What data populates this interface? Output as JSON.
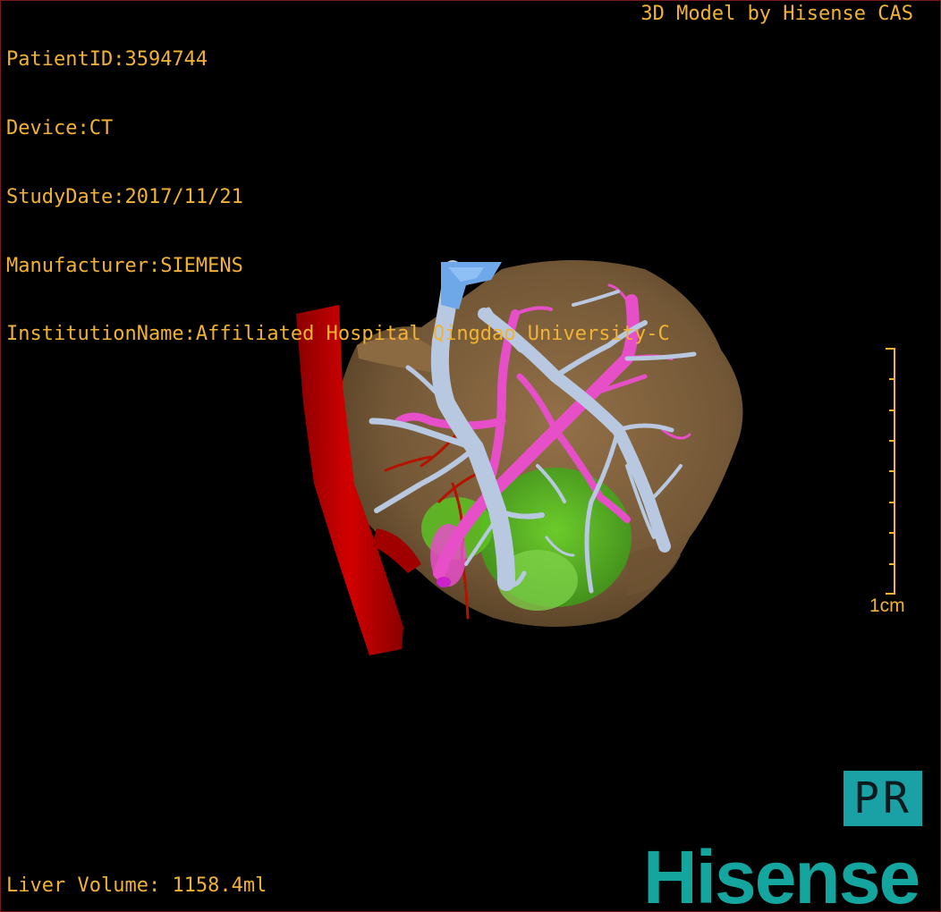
{
  "patient_info": [
    {
      "label": "PatientID:",
      "value": "3594744"
    },
    {
      "label": "Device:",
      "value": "CT"
    },
    {
      "label": "StudyDate:",
      "value": "2017/11/21"
    },
    {
      "label": "Manufacturer:",
      "value": "SIEMENS"
    },
    {
      "label": "InstitutionName:",
      "value": "Affiliated Hospital Qingdao University-C"
    }
  ],
  "credit": "3D Model by Hisense CAS",
  "footer": {
    "volume_label": "Liver Volume:",
    "volume_value": "1158.4ml"
  },
  "scale_bar": {
    "label": "1cm"
  },
  "pr_button_label": "PR",
  "brand": "Hisense",
  "colors": {
    "overlay_text": "#f2b233",
    "liver": "#8a6a45",
    "hepatic_vein": "#b7c8e0",
    "portal_vein": "#e64fc8",
    "ivc": "#c00000",
    "tumor": "#55c41e",
    "brand": "#14a59f"
  },
  "icons": {
    "pr_button": "pr-mode-icon",
    "brand_logo": "hisense-logo"
  }
}
